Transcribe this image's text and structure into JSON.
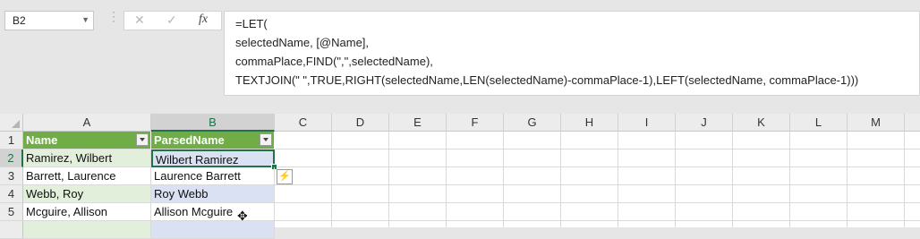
{
  "namebox": {
    "value": "B2",
    "dropdown_icon": "▼"
  },
  "toolbar": {
    "separator": "⋮",
    "cancel_icon": "✕",
    "enter_icon": "✓",
    "fx_label": "fx"
  },
  "formula_bar": {
    "lines": [
      "=LET(",
      "selectedName, [@Name],",
      "commaPlace,FIND(\",\",selectedName),",
      "TEXTJOIN(\" \",TRUE,RIGHT(selectedName,LEN(selectedName)-commaPlace-1),LEFT(selectedName, commaPlace-1)))"
    ]
  },
  "columns": [
    "A",
    "B",
    "C",
    "D",
    "E",
    "F",
    "G",
    "H",
    "I",
    "J",
    "K",
    "L",
    "M"
  ],
  "rows": [
    "1",
    "2",
    "3",
    "4",
    "5"
  ],
  "table": {
    "headers": [
      "Name",
      "ParsedName"
    ],
    "data": [
      [
        "Ramirez, Wilbert",
        "Wilbert Ramirez"
      ],
      [
        "Barrett, Laurence",
        "Laurence Barrett"
      ],
      [
        "Webb, Roy",
        "Roy Webb"
      ],
      [
        "Mcguire, Allison",
        "Allison Mcguire"
      ]
    ]
  },
  "colors": {
    "header": "#70ad47",
    "bandA": "#e2efda",
    "bandB": "#d9e1f2",
    "selection": "#217346"
  },
  "flash_fill_icon": "⚡",
  "cursor_icon": "✥"
}
